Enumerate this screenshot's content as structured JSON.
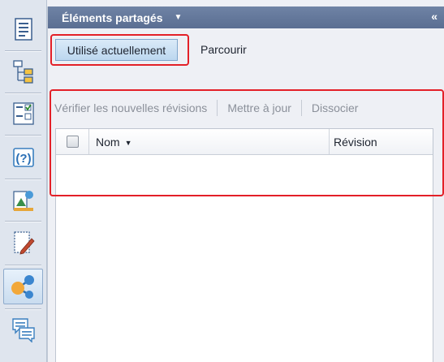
{
  "toolbar": {
    "items": [
      {
        "name": "document-outline-icon"
      },
      {
        "name": "hierarchy-icon"
      },
      {
        "name": "form-checklist-icon"
      },
      {
        "name": "help-query-icon"
      },
      {
        "name": "chart-publish-icon"
      },
      {
        "name": "edit-document-icon"
      },
      {
        "name": "shared-elements-icon",
        "active": true
      },
      {
        "name": "comments-icon"
      }
    ]
  },
  "panel": {
    "title": "Éléments partagés",
    "title_caret": "▼",
    "collapse_glyph": "«"
  },
  "tabs": {
    "current": "Utilisé actuellement",
    "browse": "Parcourir"
  },
  "actions": {
    "check_revisions": "Vérifier les nouvelles révisions",
    "update": "Mettre à jour",
    "unlink": "Dissocier"
  },
  "table": {
    "columns": {
      "name": "Nom",
      "revision": "Révision"
    },
    "rows": []
  },
  "colors": {
    "header_bg": "#5f7398",
    "highlight": "#e32028",
    "active_tab_bg": "#c8e0f4"
  }
}
